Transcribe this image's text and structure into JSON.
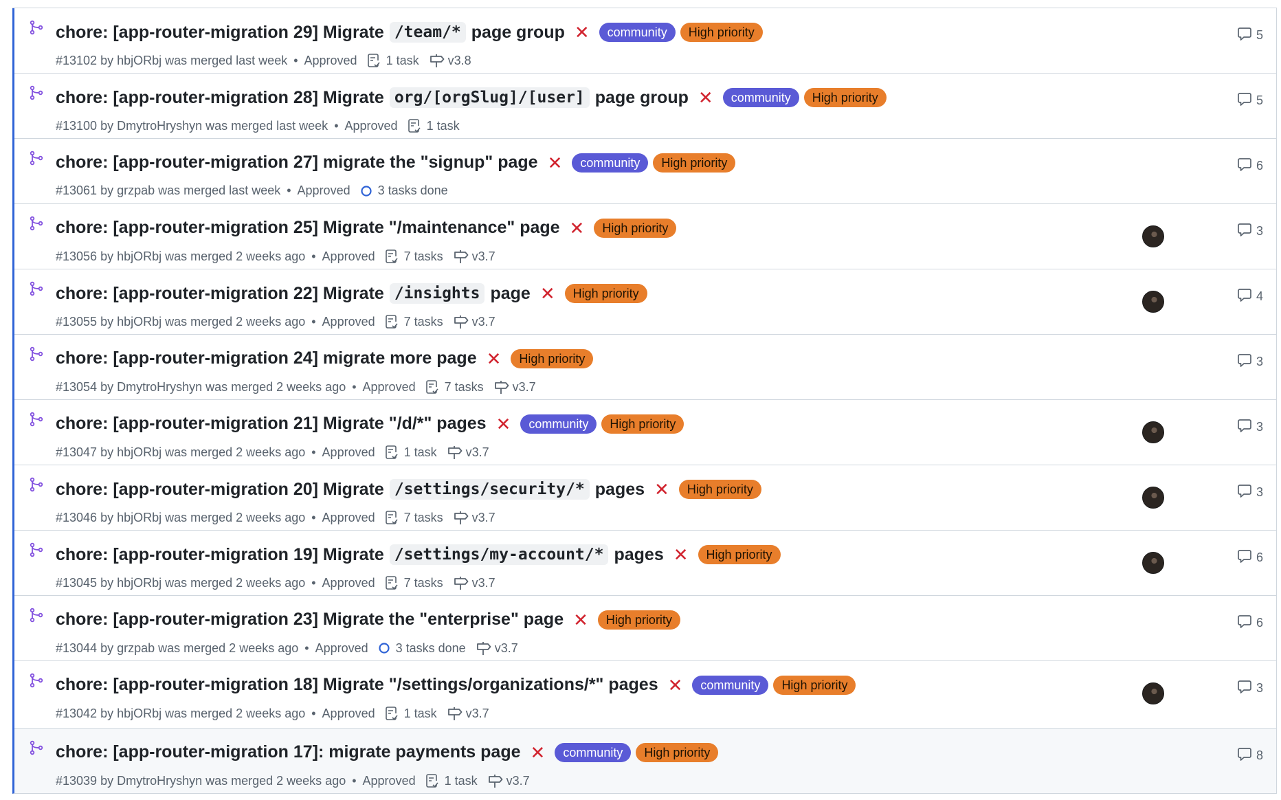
{
  "colors": {
    "accent": "#2f63d6",
    "merged": "#8250df",
    "closed": "#d1242f",
    "community": "#5a5ad6",
    "high_priority": "#e87e2b"
  },
  "icons": {
    "pr": "git-merge-icon",
    "tasks": "checklist-icon",
    "milestone": "milestone-icon",
    "comment": "comment-icon",
    "status": "x-icon",
    "tasks_done": "progress-ring-icon"
  },
  "status_x": "✕",
  "separator": "•",
  "pulls": [
    {
      "title": [
        {
          "t": "chore: [app-router-migration 29] Migrate"
        },
        {
          "c": "/team/*"
        },
        {
          "t": "page group"
        }
      ],
      "labels": [
        "community",
        "High priority"
      ],
      "number": "#13102",
      "author": "hbjORbj",
      "merged": "was merged last week",
      "review": "Approved",
      "tasks": "1 task",
      "tasks_done": false,
      "milestone": "v3.8",
      "avatar": false,
      "comments": "5"
    },
    {
      "title": [
        {
          "t": "chore: [app-router-migration 28] Migrate"
        },
        {
          "c": "org/[orgSlug]/[user]"
        },
        {
          "t": "page group"
        }
      ],
      "labels": [
        "community",
        "High priority"
      ],
      "number": "#13100",
      "author": "DmytroHryshyn",
      "merged": "was merged last week",
      "review": "Approved",
      "tasks": "1 task",
      "tasks_done": false,
      "milestone": "",
      "avatar": false,
      "comments": "5"
    },
    {
      "title": [
        {
          "t": "chore: [app-router-migration 27] migrate the \"signup\" page"
        }
      ],
      "labels": [
        "community",
        "High priority"
      ],
      "number": "#13061",
      "author": "grzpab",
      "merged": "was merged last week",
      "review": "Approved",
      "tasks": "3 tasks done",
      "tasks_done": true,
      "milestone": "",
      "avatar": false,
      "comments": "6"
    },
    {
      "title": [
        {
          "t": "chore: [app-router-migration 25] Migrate \"/maintenance\" page"
        }
      ],
      "labels": [
        "High priority"
      ],
      "number": "#13056",
      "author": "hbjORbj",
      "merged": "was merged 2 weeks ago",
      "review": "Approved",
      "tasks": "7 tasks",
      "tasks_done": false,
      "milestone": "v3.7",
      "avatar": true,
      "comments": "3"
    },
    {
      "title": [
        {
          "t": "chore: [app-router-migration 22] Migrate"
        },
        {
          "c": "/insights"
        },
        {
          "t": "page"
        }
      ],
      "labels": [
        "High priority"
      ],
      "number": "#13055",
      "author": "hbjORbj",
      "merged": "was merged 2 weeks ago",
      "review": "Approved",
      "tasks": "7 tasks",
      "tasks_done": false,
      "milestone": "v3.7",
      "avatar": true,
      "comments": "4"
    },
    {
      "title": [
        {
          "t": "chore: [app-router-migration 24] migrate more page"
        }
      ],
      "labels": [
        "High priority"
      ],
      "number": "#13054",
      "author": "DmytroHryshyn",
      "merged": "was merged 2 weeks ago",
      "review": "Approved",
      "tasks": "7 tasks",
      "tasks_done": false,
      "milestone": "v3.7",
      "avatar": false,
      "comments": "3"
    },
    {
      "title": [
        {
          "t": "chore: [app-router-migration 21] Migrate \"/d/*\" pages"
        }
      ],
      "labels": [
        "community",
        "High priority"
      ],
      "number": "#13047",
      "author": "hbjORbj",
      "merged": "was merged 2 weeks ago",
      "review": "Approved",
      "tasks": "1 task",
      "tasks_done": false,
      "milestone": "v3.7",
      "avatar": true,
      "comments": "3"
    },
    {
      "title": [
        {
          "t": "chore: [app-router-migration 20] Migrate"
        },
        {
          "c": "/settings/security/*"
        },
        {
          "t": "pages"
        }
      ],
      "labels": [
        "High priority"
      ],
      "number": "#13046",
      "author": "hbjORbj",
      "merged": "was merged 2 weeks ago",
      "review": "Approved",
      "tasks": "7 tasks",
      "tasks_done": false,
      "milestone": "v3.7",
      "avatar": true,
      "comments": "3"
    },
    {
      "title": [
        {
          "t": "chore: [app-router-migration 19] Migrate"
        },
        {
          "c": "/settings/my-account/*"
        },
        {
          "t": "pages"
        }
      ],
      "labels": [
        "High priority"
      ],
      "number": "#13045",
      "author": "hbjORbj",
      "merged": "was merged 2 weeks ago",
      "review": "Approved",
      "tasks": "7 tasks",
      "tasks_done": false,
      "milestone": "v3.7",
      "avatar": true,
      "comments": "6"
    },
    {
      "title": [
        {
          "t": "chore: [app-router-migration 23] Migrate the \"enterprise\" page"
        }
      ],
      "labels": [
        "High priority"
      ],
      "number": "#13044",
      "author": "grzpab",
      "merged": "was merged 2 weeks ago",
      "review": "Approved",
      "tasks": "3 tasks done",
      "tasks_done": true,
      "milestone": "v3.7",
      "avatar": false,
      "comments": "6"
    },
    {
      "title": [
        {
          "t": "chore: [app-router-migration 18] Migrate \"/settings/organizations/*\" pages"
        }
      ],
      "labels": [
        "community",
        "High priority"
      ],
      "number": "#13042",
      "author": "hbjORbj",
      "merged": "was merged 2 weeks ago",
      "review": "Approved",
      "tasks": "1 task",
      "tasks_done": false,
      "milestone": "v3.7",
      "avatar": true,
      "comments": "3"
    },
    {
      "title": [
        {
          "t": "chore: [app-router-migration 17]: migrate payments page"
        }
      ],
      "labels": [
        "community",
        "High priority"
      ],
      "number": "#13039",
      "author": "DmytroHryshyn",
      "merged": "was merged 2 weeks ago",
      "review": "Approved",
      "tasks": "1 task",
      "tasks_done": false,
      "milestone": "v3.7",
      "avatar": false,
      "comments": "8"
    }
  ]
}
